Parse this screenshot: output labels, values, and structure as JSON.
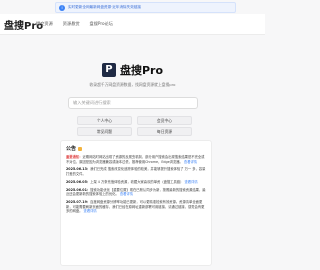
{
  "notice": {
    "text": "实时更新全网最新网盘资源·近年消除失效链接"
  },
  "header": {
    "brand": "盘搜Pro",
    "nav": [
      "提交资源",
      "资源悬赏",
      "盘搜Pro论坛"
    ]
  },
  "hero": {
    "logo_letter": "P",
    "title": "盘搜Pro",
    "tagline": "收录超千万网盘资源数据，找网盘资源就上盘搜pro"
  },
  "search": {
    "placeholder": "输入关键词进行搜索"
  },
  "buttons": [
    "个人中心",
    "会员中心",
    "常见问题",
    "每日资源"
  ],
  "announcement": {
    "title": "公告",
    "p1_label": "重要通知：",
    "p1_text": "近期网站时网站出现了资源的反爬虫机制，部分用户搜索会出现搜索结果是不完全或不对位，原因是因为浏览器兼容或版本过低，推荐使用Chrome，Edge浏览器。",
    "p1_link": "查看详情",
    "p2_date": "2025.06.13：",
    "p2_text": "我们已完成 搜索改变化追踪体验的较美，并能够提升搜索体验了 万一 多，容量打差的文件。",
    "p3_date": "2025.06.05：",
    "p3_text": "上架 4 万条充值体验资源，收藏大家喜欢的单资（盘搜工具链）",
    "p3_link": "查看详情",
    "p4_date": "2025.06.01：",
    "p4_text": "搜索功能优化【重要位置】现在已默认同步为新，按照最新的搜索资源结果，最近还会更新新的搜索体验上的优化。",
    "p4_link": "查看详情",
    "p5_date": "2025.07.19：",
    "p5_text": "百度网盘资源分辨率功能已更新，可以更精准检索有效资源。资源清单全面更新，可能需要刷新页面的缓存，我们已经在原网址重新部署可用链接，请通过链接，感觉会有更多的网盘。",
    "p5_link": "查看详情"
  }
}
